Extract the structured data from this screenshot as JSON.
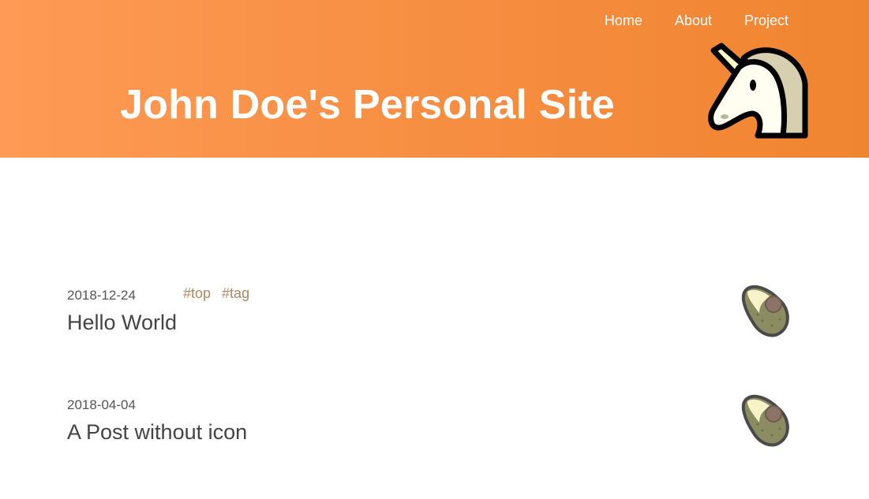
{
  "nav": {
    "items": [
      {
        "label": "Home"
      },
      {
        "label": "About"
      },
      {
        "label": "Project"
      }
    ]
  },
  "header": {
    "title": "John Doe's Personal Site",
    "logo_icon": "unicorn-icon",
    "gradient_start": "#fe9a55",
    "gradient_end": "#f08530"
  },
  "posts": [
    {
      "date": "2018-12-24",
      "title": "Hello World",
      "tags": [
        "#top",
        "#tag"
      ],
      "icon": "avocado-icon"
    },
    {
      "date": "2018-04-04",
      "title": "A Post without icon",
      "tags": [],
      "icon": "avocado-icon"
    }
  ],
  "colors": {
    "tag": "#b08862",
    "text": "#444444"
  }
}
